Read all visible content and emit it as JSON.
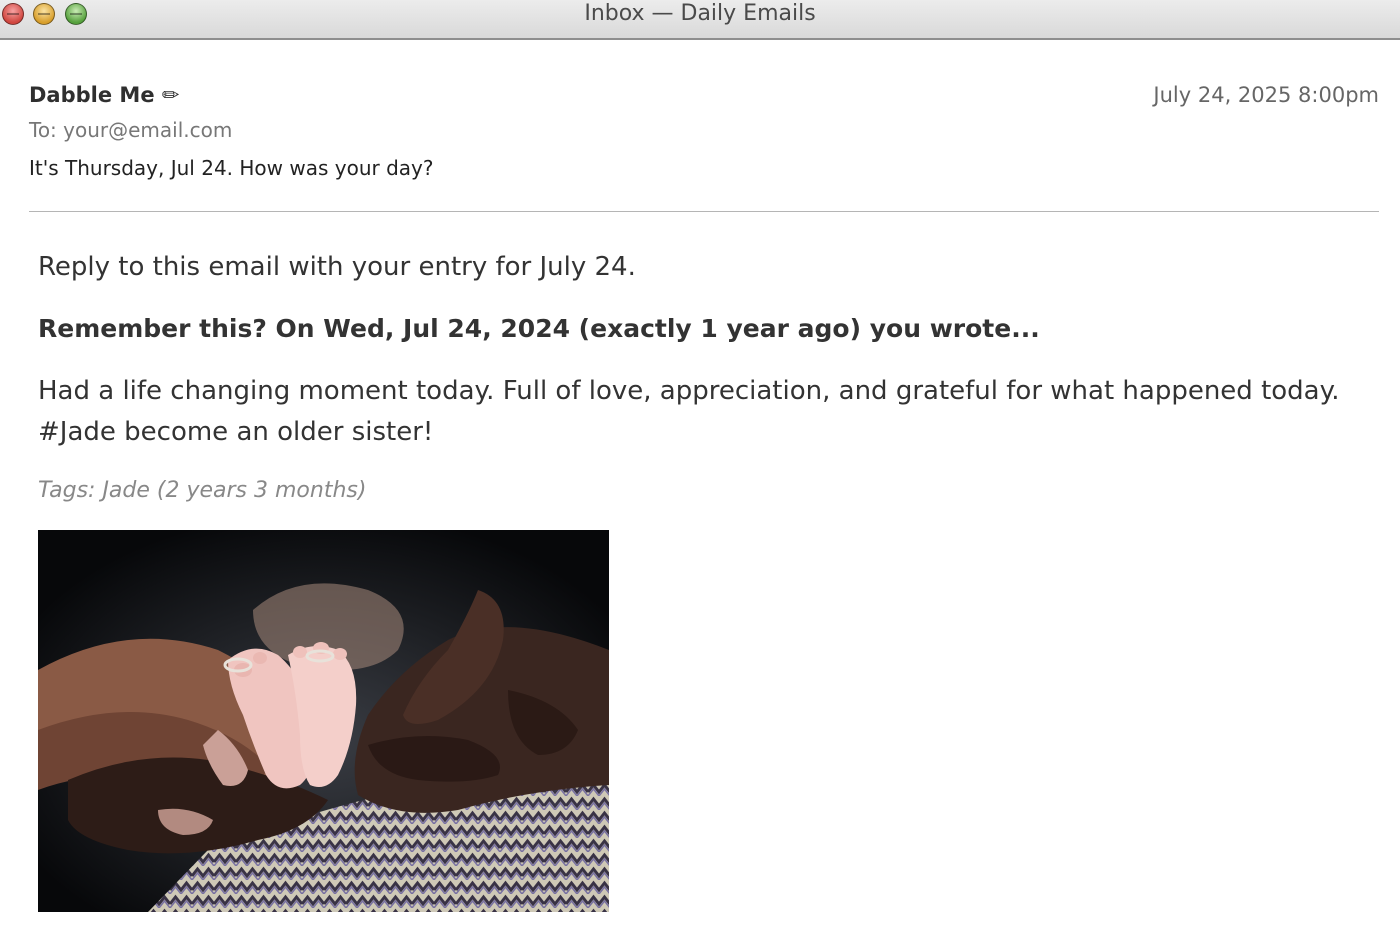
{
  "window": {
    "title": "Inbox — Daily Emails"
  },
  "email": {
    "sender": "Dabble Me ✏",
    "date": "July 24, 2025 8:00pm",
    "to": "To: your@email.com",
    "subject": "It's Thursday, Jul 24. How was your day?"
  },
  "body": {
    "reply_prompt": "Reply to this email with your entry for July 24.",
    "remember_heading": "Remember this? On Wed, Jul 24, 2024 (exactly 1 year ago) you wrote...",
    "entry_text": "Had a life changing moment today. Full of love, appreciation, and grateful for what happened today. #Jade become an older sister!",
    "tags": "Tags: Jade (2 years 3 months)"
  },
  "colors": {
    "accent_text": "#333333",
    "muted_text": "#888888",
    "titlebar": "#e3e3e3"
  }
}
